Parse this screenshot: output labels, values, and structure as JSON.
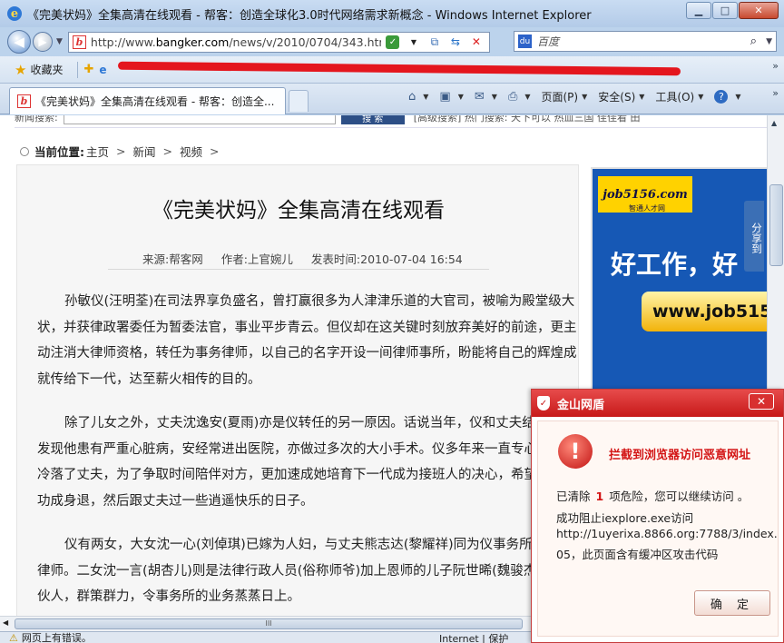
{
  "window": {
    "title": "《完美状妈》全集高清在线观看 - 帮客：创造全球化3.0时代网络需求新概念 - Windows Internet Explorer",
    "minimize": "▁",
    "maximize": "□",
    "close": "✕"
  },
  "address": {
    "url_prefix": "http://www.",
    "url_domain": "bangker.com",
    "url_path": "/news/v/2010/0704/343.html#"
  },
  "search": {
    "engine_logo": "du",
    "placeholder": "百度"
  },
  "favorites": {
    "label": "收藏夹"
  },
  "tabs": [
    {
      "title": "《完美状妈》全集高清在线观看 - 帮客：创造全..."
    }
  ],
  "commands": [
    {
      "label": "页面(P)",
      "icon": "page-icon"
    },
    {
      "label": "安全(S)",
      "icon": "safety-icon"
    },
    {
      "label": "工具(O)",
      "icon": "tools-icon"
    }
  ],
  "page": {
    "topstrip_label": "新闻搜索:",
    "topstrip_btn": "搜 索",
    "topstrip_links": "[高级搜索]  热门搜索:  天下可以  热血三国  佳佳看  田",
    "breadcrumb": {
      "label": "当前位置:",
      "items": [
        "主页",
        "新闻",
        "视频"
      ],
      "separator": ">"
    },
    "article": {
      "title": "《完美状妈》全集高清在线观看",
      "source": "来源:帮客网",
      "author": "作者:上官婉儿",
      "time": "发表时间:2010-07-04 16:54",
      "paragraphs": [
        "孙敏仪(汪明荃)在司法界享负盛名，曾打赢很多为人津津乐道的大官司，被喻为殿堂级大状，并获律政署委任为暂委法官，事业平步青云。但仪却在这关键时刻放弃美好的前途，更主动注消大律师资格，转任为事务律师，以自己的名字开设一间律师事所，盼能将自己的辉煌成就传给下一代，达至薪火相传的目的。",
        "除了儿女之外，丈夫沈逸安(夏雨)亦是仪转任的另一原因。话说当年，仪和丈夫结婚，即发现他患有严重心脏病，安经常进出医院，亦做过多次的大小手术。仪多年来一直专心事业，冷落了丈夫，为了争取时间陪伴对方，更加速成她培育下一代成为接班人的决心，希望以早日功成身退，然后跟丈夫过一些逍遥快乐的日子。",
        "仪有两女，大女沈一心(刘倬琪)已嫁为人妇，与丈夫熊志达(黎耀祥)同为仪事务所旗下的律师。二女沈一言(胡杏儿)则是法律行政人员(俗称师爷)加上恩师的儿子阮世晞(魏骏杰)同为合伙人，群策群力，令事务所的业务蒸蒸日上。"
      ]
    },
    "ad": {
      "logo": "job5156.com",
      "logo_sub": "智通人才网",
      "slogan": "好工作，好",
      "url": "www.job5156"
    },
    "share_label": "分享到"
  },
  "scroll": {
    "h_thumb_grip": "III"
  },
  "status": {
    "text": "网页上有错误。",
    "zone": "Internet | 保护"
  },
  "popup": {
    "title": "金山网盾",
    "close": "✕",
    "headline": "拦截到浏览器访问恶意网址",
    "cleared_prefix": "已清除",
    "cleared_count": "1",
    "cleared_suffix": "项危险，您可以继续访问 。",
    "blocked_line": "成功阻止iexplore.exe访问",
    "bad_url": "http://1uyerixa.8866.org:7788/3/index.",
    "detail": "05，此页面含有缓冲区攻击代码",
    "ok": "确 定"
  },
  "colors": {
    "popup_red": "#c71919",
    "ad_blue": "#1658b5",
    "ad_yellow": "#ffd200",
    "titlebar": "#c9dcf2"
  }
}
